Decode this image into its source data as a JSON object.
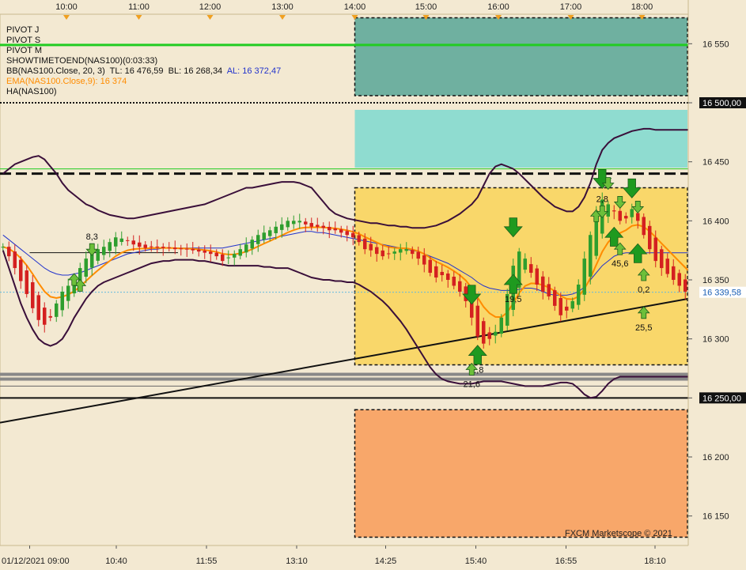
{
  "legend": {
    "pivot_j": "PIVOT J",
    "pivot_s": "PIVOT S",
    "pivot_m": "PIVOT M",
    "showtime": "SHOWTIMETOEND(NAS100)(0:03:33)",
    "bb_prefix": "BB(NAS100.Close, 20, 3)",
    "bb_tl": "TL: 16 476,59",
    "bb_bl": "BL: 16 268,34",
    "bb_al": "AL: 16 372,47",
    "ema": "EMA(NAS100.Close,9): 16 374",
    "ha": "HA(NAS100)"
  },
  "watermark": "FXCM Marketscope © 2021",
  "colors": {
    "background": "#f3e9d2",
    "bull": "#2e9e2e",
    "bear": "#d42020",
    "bb_band": "#3a0f3a",
    "ema": "#ff8c00",
    "al": "#2233cc",
    "zone_top": "#6fb0a0",
    "zone_cyan": "#8fdcd0",
    "zone_yellow": "#f9d76a",
    "zone_orange": "#f8a76a",
    "pivot_green": "#22cc22",
    "arrow_green": "#2ea52e"
  },
  "chart_data": {
    "type": "candlestick",
    "instrument": "NAS100",
    "ylim": [
      16125,
      16575
    ],
    "y_ticks": [
      16150,
      16200,
      16250,
      16300,
      16350,
      16400,
      16450,
      16500,
      16550
    ],
    "y_tick_labels": [
      "16 150",
      "16 200",
      "16 250",
      "16 300",
      "16 350",
      "16 400",
      "16 450",
      "16 500,00",
      "16 550"
    ],
    "highlighted_y_labels": [
      {
        "value": 16500,
        "text": "16 500,00"
      },
      {
        "value": 16250,
        "text": "16 250,00"
      },
      {
        "value": 16339.5,
        "text": "16 339,58"
      }
    ],
    "bar_range": [
      0,
      116
    ],
    "top_time_ticks": [
      {
        "bar": 11.2,
        "label": "10:00"
      },
      {
        "bar": 23.4,
        "label": "11:00"
      },
      {
        "bar": 35.4,
        "label": "12:00"
      },
      {
        "bar": 47.6,
        "label": "13:00"
      },
      {
        "bar": 59.8,
        "label": "14:00"
      },
      {
        "bar": 71.8,
        "label": "15:00"
      },
      {
        "bar": 84.0,
        "label": "16:00"
      },
      {
        "bar": 96.2,
        "label": "17:00"
      },
      {
        "bar": 108.2,
        "label": "18:00"
      }
    ],
    "bottom_time_ticks": [
      {
        "bar": 5,
        "label": "01/12/2021 09:00"
      },
      {
        "bar": 19.6,
        "label": "10:40"
      },
      {
        "bar": 34.8,
        "label": "11:55"
      },
      {
        "bar": 50.0,
        "label": "13:10"
      },
      {
        "bar": 65.0,
        "label": "14:25"
      },
      {
        "bar": 80.2,
        "label": "15:40"
      },
      {
        "bar": 95.4,
        "label": "16:55"
      },
      {
        "bar": 110.4,
        "label": "18:10"
      }
    ],
    "closes": [
      16378,
      16370,
      16360,
      16349,
      16338,
      16326,
      16316,
      16312,
      16318,
      16330,
      16340,
      16345,
      16352,
      16360,
      16368,
      16372,
      16376,
      16378,
      16382,
      16386,
      16385,
      16383,
      16380,
      16378,
      16377,
      16378,
      16378,
      16377,
      16377,
      16376,
      16376,
      16376,
      16375,
      16374,
      16373,
      16372,
      16370,
      16366,
      16369,
      16372,
      16376,
      16380,
      16384,
      16388,
      16390,
      16392,
      16395,
      16397,
      16400,
      16400,
      16400,
      16397,
      16395,
      16395,
      16394,
      16392,
      16392,
      16390,
      16388,
      16386,
      16382,
      16376,
      16375,
      16372,
      16370,
      16372,
      16374,
      16376,
      16376,
      16372,
      16368,
      16363,
      16356,
      16352,
      16354,
      16350,
      16345,
      16340,
      16332,
      16318,
      16302,
      16296,
      16300,
      16306,
      16318,
      16338,
      16362,
      16374,
      16368,
      16356,
      16346,
      16340,
      16336,
      16328,
      16320,
      16324,
      16332,
      16346,
      16368,
      16388,
      16408,
      16418,
      16414,
      16408,
      16400,
      16402,
      16410,
      16400,
      16388,
      16376,
      16366,
      16360,
      16355,
      16350,
      16345,
      16340,
      16336
    ],
    "bb_upper": [
      16440,
      16444,
      16448,
      16450,
      16452,
      16454,
      16455,
      16452,
      16446,
      16440,
      16432,
      16426,
      16422,
      16418,
      16414,
      16412,
      16409,
      16407,
      16405,
      16404,
      16403,
      16402,
      16402,
      16403,
      16404,
      16405,
      16406,
      16407,
      16408,
      16409,
      16410,
      16411,
      16412,
      16413,
      16414,
      16416,
      16418,
      16420,
      16422,
      16424,
      16426,
      16428,
      16428,
      16429,
      16430,
      16431,
      16432,
      16433,
      16433,
      16433,
      16432,
      16430,
      16428,
      16422,
      16416,
      16410,
      16406,
      16404,
      16402,
      16401,
      16400,
      16399,
      16398,
      16398,
      16397,
      16396,
      16396,
      16395,
      16395,
      16394,
      16394,
      16394,
      16395,
      16396,
      16398,
      16400,
      16403,
      16406,
      16410,
      16414,
      16420,
      16430,
      16440,
      16446,
      16448,
      16446,
      16444,
      16440,
      16435,
      16430,
      16425,
      16420,
      16416,
      16412,
      16410,
      16408,
      16408,
      16412,
      16420,
      16432,
      16448,
      16460,
      16466,
      16470,
      16472,
      16474,
      16476,
      16477,
      16478,
      16478,
      16477,
      16477,
      16477,
      16477,
      16477,
      16477,
      16477
    ],
    "bb_lower": [
      16375,
      16360,
      16345,
      16330,
      16318,
      16308,
      16300,
      16296,
      16294,
      16296,
      16300,
      16308,
      16318,
      16326,
      16334,
      16340,
      16345,
      16348,
      16350,
      16352,
      16354,
      16356,
      16358,
      16360,
      16362,
      16364,
      16365,
      16366,
      16366,
      16367,
      16367,
      16367,
      16367,
      16366,
      16366,
      16365,
      16364,
      16363,
      16362,
      16362,
      16362,
      16362,
      16362,
      16362,
      16361,
      16361,
      16360,
      16360,
      16360,
      16358,
      16356,
      16354,
      16352,
      16351,
      16350,
      16350,
      16349,
      16349,
      16348,
      16348,
      16346,
      16343,
      16340,
      16336,
      16332,
      16327,
      16321,
      16315,
      16308,
      16300,
      16292,
      16284,
      16276,
      16270,
      16266,
      16264,
      16263,
      16262,
      16262,
      16262,
      16263,
      16264,
      16264,
      16264,
      16264,
      16263,
      16262,
      16261,
      16260,
      16260,
      16260,
      16260,
      16261,
      16262,
      16263,
      16263,
      16262,
      16258,
      16253,
      16250,
      16251,
      16256,
      16262,
      16266,
      16268,
      16268,
      16268,
      16268,
      16268,
      16268,
      16268,
      16268,
      16268,
      16268,
      16268,
      16268,
      16268
    ],
    "bb_middle": [
      16388,
      16384,
      16380,
      16376,
      16372,
      16368,
      16364,
      16360,
      16357,
      16355,
      16354,
      16354,
      16355,
      16356,
      16358,
      16360,
      16362,
      16364,
      16366,
      16368,
      16370,
      16372,
      16373,
      16374,
      16375,
      16376,
      16376,
      16377,
      16377,
      16377,
      16377,
      16377,
      16377,
      16377,
      16377,
      16377,
      16377,
      16377,
      16378,
      16379,
      16380,
      16381,
      16382,
      16383,
      16384,
      16385,
      16386,
      16387,
      16388,
      16389,
      16390,
      16391,
      16391,
      16390,
      16390,
      16389,
      16388,
      16387,
      16386,
      16385,
      16384,
      16383,
      16382,
      16381,
      16380,
      16379,
      16378,
      16377,
      16376,
      16375,
      16374,
      16372,
      16370,
      16368,
      16366,
      16364,
      16361,
      16358,
      16355,
      16352,
      16348,
      16345,
      16343,
      16342,
      16341,
      16341,
      16341,
      16342,
      16343,
      16343,
      16342,
      16340,
      16338,
      16337,
      16337,
      16337,
      16338,
      16340,
      16344,
      16350,
      16356,
      16362,
      16366,
      16370,
      16372,
      16373,
      16373,
      16373,
      16373,
      16373,
      16373,
      16373,
      16373,
      16373,
      16373,
      16373,
      16373
    ],
    "pivots": [
      {
        "name": "top-solid-green",
        "value": 16549,
        "style": "solid",
        "color": "#22cc22"
      },
      {
        "name": "dotted-16500",
        "value": 16500,
        "style": "dotted",
        "color": "#111"
      },
      {
        "name": "thin-green",
        "value": 16444,
        "style": "solid-thin",
        "color": "#22cc22"
      },
      {
        "name": "dashed-thick",
        "value": 16440,
        "style": "dashed",
        "color": "#111"
      },
      {
        "name": "gray-band-1",
        "value": 16270,
        "style": "solid-gray",
        "color": "#888"
      },
      {
        "name": "gray-band-2",
        "value": 16266,
        "style": "solid-gray",
        "color": "#888"
      },
      {
        "name": "gray-band-3",
        "value": 16260,
        "style": "solid-thin",
        "color": "#666"
      },
      {
        "name": "black-16250",
        "value": 16250,
        "style": "solid",
        "color": "#111"
      },
      {
        "name": "dotted-cyan-price",
        "value": 16339.5,
        "style": "dotted-cyan",
        "color": "#66bbdd"
      },
      {
        "name": "short-black-left",
        "value": 16373,
        "style": "segment",
        "color": "#111",
        "bar_from": 5,
        "bar_to": 30
      }
    ],
    "zones": [
      {
        "name": "zone-top-teal",
        "bar_from": 59.8,
        "bar_to": 116,
        "y_from": 16506,
        "y_to": 16572,
        "color": "#6fb0a0",
        "border": "dashed"
      },
      {
        "name": "zone-cyan",
        "bar_from": 59.8,
        "bar_to": 116,
        "y_from": 16445,
        "y_to": 16494,
        "color": "#8fdcd0",
        "border": "none"
      },
      {
        "name": "zone-yellow",
        "bar_from": 59.8,
        "bar_to": 116,
        "y_from": 16278,
        "y_to": 16428,
        "color": "#f9d76a",
        "border": "dashed"
      },
      {
        "name": "zone-orange",
        "bar_from": 59.8,
        "bar_to": 116,
        "y_from": 16132,
        "y_to": 16240,
        "color": "#f8a76a",
        "border": "dashed"
      }
    ],
    "trendline": {
      "bar_from": 0,
      "y_from": 16229,
      "bar_to": 116,
      "y_to": 16334
    },
    "annotations": [
      {
        "bar": 15,
        "value": 16376,
        "text": "8,3",
        "dir": "down",
        "big": false
      },
      {
        "bar": 101,
        "value": 16408,
        "text": "2,8",
        "dir": "down",
        "big": false
      },
      {
        "bar": 104,
        "value": 16376,
        "text": "45,6",
        "dir": "up",
        "big": false
      },
      {
        "bar": 108,
        "value": 16354,
        "text": "0,2",
        "dir": "up",
        "big": false
      },
      {
        "bar": 86,
        "value": 16346,
        "text": "19,5",
        "dir": "up",
        "big": true
      },
      {
        "bar": 80,
        "value": 16286,
        "text": "2,8",
        "dir": "up",
        "big": true
      },
      {
        "bar": 79,
        "value": 16274,
        "text": "21,6",
        "dir": "up",
        "big": false
      },
      {
        "bar": 108,
        "value": 16322,
        "text": "25,5",
        "dir": "up",
        "big": false
      }
    ],
    "arrows": [
      {
        "bar": 13,
        "value": 16345,
        "dir": "up"
      },
      {
        "bar": 12,
        "value": 16350,
        "dir": "up"
      },
      {
        "bar": 86,
        "value": 16395,
        "dir": "down",
        "big": true
      },
      {
        "bar": 79,
        "value": 16338,
        "dir": "down",
        "big": true
      },
      {
        "bar": 101,
        "value": 16436,
        "dir": "down",
        "big": true
      },
      {
        "bar": 102,
        "value": 16432,
        "dir": "down",
        "big": false
      },
      {
        "bar": 106,
        "value": 16428,
        "dir": "down",
        "big": true
      },
      {
        "bar": 104,
        "value": 16416,
        "dir": "down",
        "big": false
      },
      {
        "bar": 107,
        "value": 16412,
        "dir": "down",
        "big": false
      },
      {
        "bar": 100,
        "value": 16404,
        "dir": "up",
        "big": false
      },
      {
        "bar": 103,
        "value": 16386,
        "dir": "up",
        "big": true
      },
      {
        "bar": 107,
        "value": 16372,
        "dir": "up",
        "big": true
      }
    ]
  }
}
